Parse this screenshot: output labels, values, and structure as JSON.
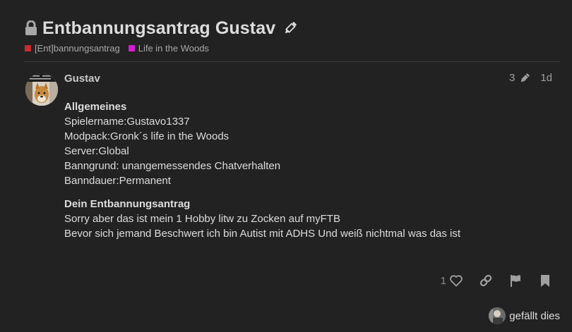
{
  "topic": {
    "title": "Entbannungsantrag Gustav",
    "icons": {
      "lock": "lock-icon",
      "edit": "pencil-icon"
    },
    "categories": [
      {
        "label": "[Ent]bannungsantrag",
        "color": "#c62c2c"
      },
      {
        "label": "Life in the Woods",
        "color": "#d11ed1"
      }
    ]
  },
  "post": {
    "username": "Gustav",
    "edit_count": "3",
    "age": "1d",
    "sections": [
      {
        "heading": "Allgemeines",
        "lines": [
          "Spielername:Gustavo1337",
          "Modpack:Gronk´s life in the Woods",
          "Server:Global",
          "Banngrund: unangemessendes Chatverhalten",
          "Banndauer:Permanent"
        ]
      },
      {
        "heading": "Dein Entbannungsantrag",
        "lines": [
          "Sorry aber das ist mein 1 Hobby litw zu Zocken auf myFTB",
          "Bevor sich jemand Beschwert ich bin Autist mit ADHS Und weiß nichtmal was das ist"
        ]
      }
    ]
  },
  "actions": {
    "like_count": "1",
    "icons": [
      "heart-icon",
      "link-icon",
      "flag-icon",
      "bookmark-icon"
    ]
  },
  "likers": {
    "text": "gefällt dies"
  },
  "colors": {
    "background": "#222222",
    "text": "#dddddd",
    "muted": "#a0a0a0"
  }
}
